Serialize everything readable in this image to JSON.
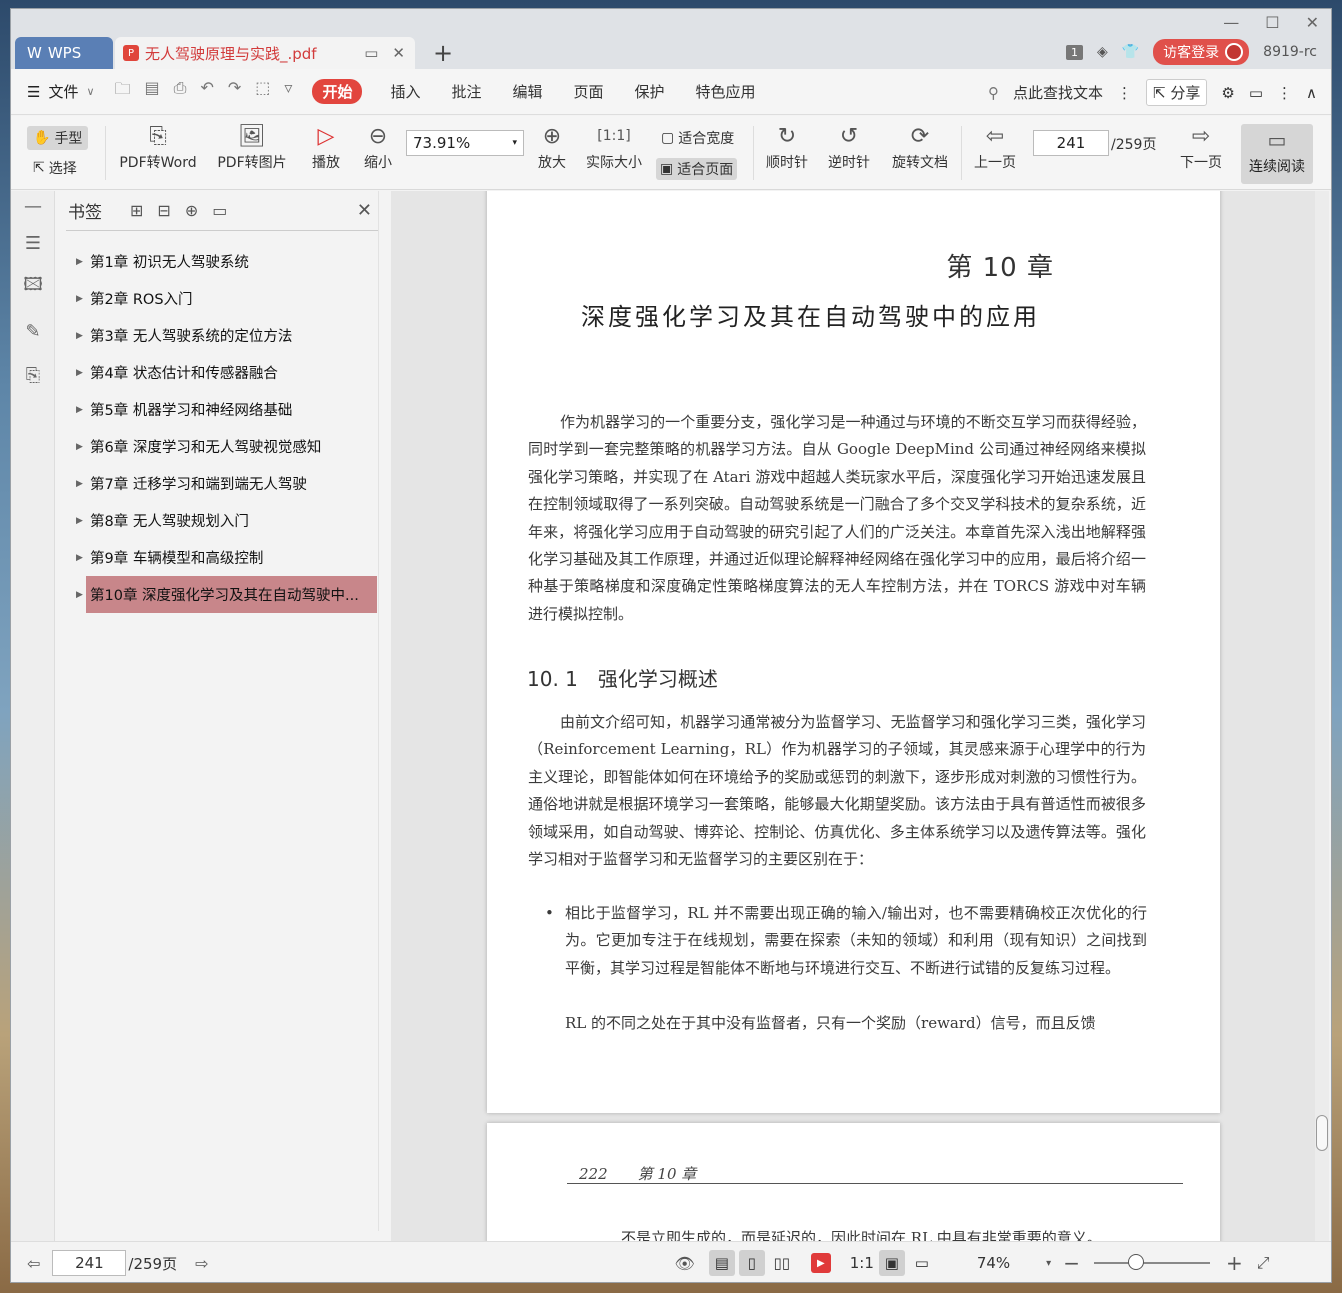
{
  "titlebar": {
    "app_tab": "WPS",
    "doc_tab": "无人驾驶原理与实践_.pdf",
    "page_badge": "1",
    "login": "访客登录",
    "user_id": "8919-rc"
  },
  "menu": {
    "file": "文件",
    "items": [
      "开始",
      "插入",
      "批注",
      "编辑",
      "页面",
      "保护",
      "特色应用"
    ],
    "search": "点此查找文本",
    "share": "分享"
  },
  "ribbon": {
    "hand": "手型",
    "select": "选择",
    "pdf_to_word": "PDF转Word",
    "pdf_to_image": "PDF转图片",
    "play": "播放",
    "zoom_out": "缩小",
    "zoom_value": "73.91%",
    "zoom_in": "放大",
    "actual_size": "实际大小",
    "fit_width": "适合宽度",
    "fit_page": "适合页面",
    "clockwise": "顺时针",
    "counterclockwise": "逆时针",
    "rotate_doc": "旋转文档",
    "prev_page": "上一页",
    "current_page": "241",
    "total_pages": "/259页",
    "next_page": "下一页",
    "continuous": "连续阅读"
  },
  "bookmarks": {
    "title": "书签",
    "items": [
      "第1章 初识无人驾驶系统",
      "第2章 ROS入门",
      "第3章 无人驾驶系统的定位方法",
      "第4章 状态估计和传感器融合",
      "第5章 机器学习和神经网络基础",
      "第6章 深度学习和无人驾驶视觉感知",
      "第7章 迁移学习和端到端无人驾驶",
      "第8章 无人驾驶规划入门",
      "第9章 车辆模型和高级控制",
      "第10章 深度强化学习及其在自动驾驶中..."
    ]
  },
  "document": {
    "chapter_number": "第 10 章",
    "chapter_title": "深度强化学习及其在自动驾驶中的应用",
    "intro": "作为机器学习的一个重要分支，强化学习是一种通过与环境的不断交互学习而获得经验，同时学到一套完整策略的机器学习方法。自从 Google DeepMind 公司通过神经网络来模拟强化学习策略，并实现了在 Atari 游戏中超越人类玩家水平后，深度强化学习开始迅速发展且在控制领域取得了一系列突破。自动驾驶系统是一门融合了多个交叉学科技术的复杂系统，近年来，将强化学习应用于自动驾驶的研究引起了人们的广泛关注。本章首先深入浅出地解释强化学习基础及其工作原理，并通过近似理论解释神经网络在强化学习中的应用，最后将介绍一种基于策略梯度和深度确定性策略梯度算法的无人车控制方法，并在 TORCS 游戏中对车辆进行模拟控制。",
    "section_title": "10. 1　强化学习概述",
    "section_para": "由前文介绍可知，机器学习通常被分为监督学习、无监督学习和强化学习三类，强化学习（Reinforcement Learning，RL）作为机器学习的子领域，其灵感来源于心理学中的行为主义理论，即智能体如何在环境给予的奖励或惩罚的刺激下，逐步形成对刺激的习惯性行为。通俗地讲就是根据环境学习一套策略，能够最大化期望奖励。该方法由于具有普适性而被很多领域采用，如自动驾驶、博弈论、控制论、仿真优化、多主体系统学习以及遗传算法等。强化学习相对于监督学习和无监督学习的主要区别在于：",
    "bullet1": "相比于监督学习，RL 并不需要出现正确的输入/输出对，也不需要精确校正次优化的行为。它更加专注于在线规划，需要在探索（未知的领域）和利用（现有知识）之间找到平衡，其学习过程是智能体不断地与环境进行交互、不断进行试错的反复练习过程。",
    "bullet2": "RL 的不同之处在于其中没有监督者，只有一个奖励（reward）信号，而且反馈",
    "page2_header": "222　　第 10 章",
    "page2_text": "不是立即生成的，而是延迟的，因此时间在 RL 中具有非常重要的意义。"
  },
  "statusbar": {
    "current_page": "241",
    "total_pages": "/259页",
    "zoom": "74%"
  }
}
